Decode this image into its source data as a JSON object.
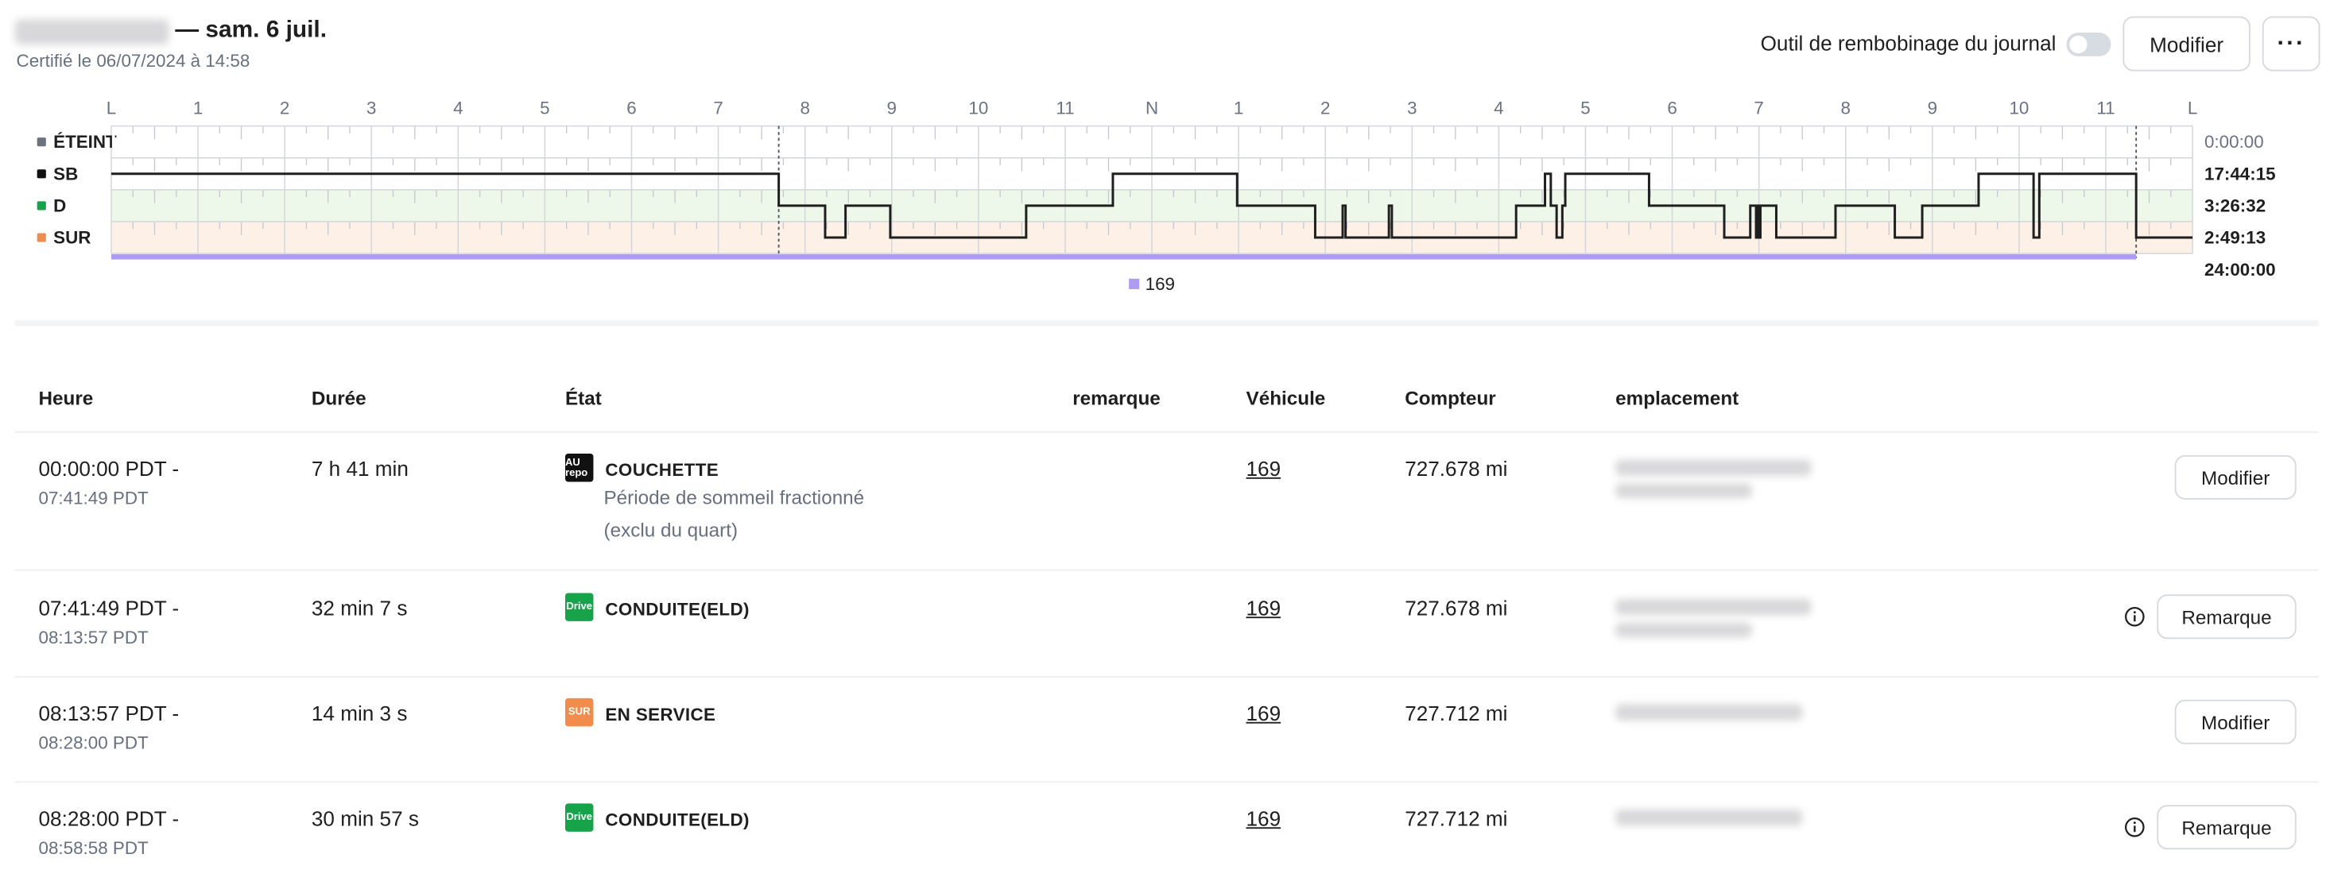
{
  "header": {
    "title": "— sam. 6 juil.",
    "certified": "Certifié le 06/07/2024 à 14:58",
    "rewind_label": "Outil de rembobinage du journal",
    "edit_label": "Modifier",
    "more_label": "···"
  },
  "chart": {
    "hour_labels": [
      "L",
      "1",
      "2",
      "3",
      "4",
      "5",
      "6",
      "7",
      "8",
      "9",
      "10",
      "11",
      "N",
      "1",
      "2",
      "3",
      "4",
      "5",
      "6",
      "7",
      "8",
      "9",
      "10",
      "11",
      "L"
    ],
    "statuses": [
      {
        "label": "ÉTEINT",
        "total": "0:00:00",
        "color": "#6b7280",
        "row_tint": "#ffffff"
      },
      {
        "label": "SB",
        "total": "17:44:15",
        "color": "#111111",
        "row_tint": "#ffffff"
      },
      {
        "label": "D",
        "total": "3:26:32",
        "color": "#16a34a",
        "row_tint": "#edf8ea"
      },
      {
        "label": "SUR",
        "total": "2:49:13",
        "color": "#f28c4d",
        "row_tint": "#fdf1e7"
      }
    ],
    "grand_total": "24:00:00",
    "line_color": "#1f1f1f",
    "vehicle_bar_color": "#ad9cf0",
    "vehicle_legend": "169",
    "duty_segments": [
      {
        "status": 1,
        "start": 0.0,
        "end": 7.697
      },
      {
        "status": 2,
        "start": 7.697,
        "end": 8.232
      },
      {
        "status": 3,
        "start": 8.232,
        "end": 8.467
      },
      {
        "status": 2,
        "start": 8.467,
        "end": 8.983
      },
      {
        "status": 3,
        "start": 8.983,
        "end": 10.55
      },
      {
        "status": 2,
        "start": 10.55,
        "end": 11.55
      },
      {
        "status": 1,
        "start": 11.55,
        "end": 12.983
      },
      {
        "status": 2,
        "start": 12.983,
        "end": 13.883
      },
      {
        "status": 3,
        "start": 13.883,
        "end": 14.2
      },
      {
        "status": 2,
        "start": 14.2,
        "end": 14.233
      },
      {
        "status": 3,
        "start": 14.233,
        "end": 14.733
      },
      {
        "status": 2,
        "start": 14.733,
        "end": 14.767
      },
      {
        "status": 3,
        "start": 14.767,
        "end": 16.2
      },
      {
        "status": 2,
        "start": 16.2,
        "end": 16.533
      },
      {
        "status": 1,
        "start": 16.533,
        "end": 16.6
      },
      {
        "status": 2,
        "start": 16.6,
        "end": 16.667
      },
      {
        "status": 3,
        "start": 16.667,
        "end": 16.733
      },
      {
        "status": 2,
        "start": 16.733,
        "end": 16.767
      },
      {
        "status": 1,
        "start": 16.767,
        "end": 17.733
      },
      {
        "status": 2,
        "start": 17.733,
        "end": 18.6
      },
      {
        "status": 3,
        "start": 18.6,
        "end": 18.9
      },
      {
        "status": 2,
        "start": 18.9,
        "end": 18.967
      },
      {
        "status": 3,
        "start": 18.967,
        "end": 18.983
      },
      {
        "status": 2,
        "start": 18.983,
        "end": 19.0
      },
      {
        "status": 3,
        "start": 19.0,
        "end": 19.017
      },
      {
        "status": 2,
        "start": 19.017,
        "end": 19.2
      },
      {
        "status": 3,
        "start": 19.2,
        "end": 19.883
      },
      {
        "status": 2,
        "start": 19.883,
        "end": 20.567
      },
      {
        "status": 3,
        "start": 20.567,
        "end": 20.883
      },
      {
        "status": 2,
        "start": 20.883,
        "end": 21.533
      },
      {
        "status": 1,
        "start": 21.533,
        "end": 22.167
      },
      {
        "status": 3,
        "start": 22.167,
        "end": 22.233
      },
      {
        "status": 1,
        "start": 22.233,
        "end": 23.35
      },
      {
        "status": 3,
        "start": 23.35,
        "end": 24.0
      }
    ]
  },
  "table": {
    "columns": [
      "Heure",
      "Durée",
      "État",
      "remarque",
      "Véhicule",
      "Compteur",
      "emplacement"
    ],
    "rows": [
      {
        "time_start": "00:00:00 PDT -",
        "time_end": "07:41:49 PDT",
        "duration": "7 h 41 min",
        "badge_text": "AU repo",
        "badge_color": "#111111",
        "state": "COUCHETTE",
        "note_line1": "Période de sommeil fractionné",
        "note_line2": "(exclu du quart)",
        "vehicle": "169",
        "odometer": "727.678 mi",
        "action": "Modifier"
      },
      {
        "time_start": "07:41:49 PDT -",
        "time_end": "08:13:57 PDT",
        "duration": "32 min 7 s",
        "badge_text": "Drive",
        "badge_color": "#16a34a",
        "state": "CONDUITE(ELD)",
        "vehicle": "169",
        "odometer": "727.678 mi",
        "action": "Remarque"
      },
      {
        "time_start": "08:13:57 PDT -",
        "time_end": "08:28:00 PDT",
        "duration": "14 min 3 s",
        "badge_text": "SUR",
        "badge_color": "#f28c4d",
        "state": "EN SERVICE",
        "vehicle": "169",
        "odometer": "727.712 mi",
        "action": "Modifier"
      },
      {
        "time_start": "08:28:00 PDT -",
        "time_end": "08:58:58 PDT",
        "duration": "30 min 57 s",
        "badge_text": "Drive",
        "badge_color": "#16a34a",
        "state": "CONDUITE(ELD)",
        "vehicle": "169",
        "odometer": "727.712 mi",
        "action": "Remarque"
      }
    ]
  }
}
